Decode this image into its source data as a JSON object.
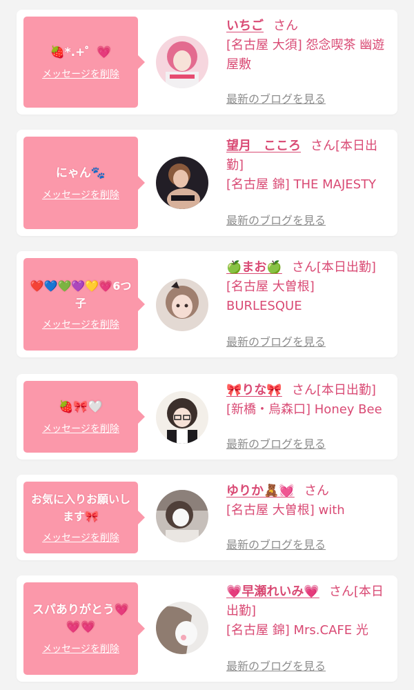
{
  "entries": [
    {
      "message": "🍓*.+゜💗",
      "delete_label": "メッセージを削除",
      "name": "いちご",
      "suffix": "さん",
      "shop": "[名古屋 大須] 怨念喫茶 幽遊屋敷",
      "blog_label": "最新のブログを見る",
      "avatar_colors": [
        "#f2b6c4",
        "#d94a74"
      ]
    },
    {
      "message": "にゃん🐾",
      "delete_label": "メッセージを削除",
      "name": "望月　こころ",
      "suffix": "さん[本日出勤]",
      "shop": "[名古屋 錦] THE MAJESTY",
      "blog_label": "最新のブログを見る",
      "avatar_colors": [
        "#2a2630",
        "#c9a48a"
      ]
    },
    {
      "message": "❤️💙💚💜💛💗6つ子",
      "delete_label": "メッセージを削除",
      "name": "🍏まお🍏",
      "suffix": "さん[本日出勤]",
      "shop": "[名古屋 大曽根] BURLESQUE",
      "blog_label": "最新のブログを見る",
      "avatar_colors": [
        "#e6dcd6",
        "#b29a8f"
      ]
    },
    {
      "message": "🍓🎀🤍",
      "delete_label": "メッセージを削除",
      "name": "🎀りな🎀",
      "suffix": "さん[本日出勤]",
      "shop": "[新橋・烏森口] Honey Bee",
      "blog_label": "最新のブログを見る",
      "avatar_colors": [
        "#f4eee8",
        "#3b2f2b"
      ]
    },
    {
      "message": "お気に入りお願いします🎀",
      "delete_label": "メッセージを削除",
      "name": "ゆりか🧸💓",
      "suffix": "さん",
      "shop": "[名古屋 大曽根] with",
      "blog_label": "最新のブログを見る",
      "avatar_colors": [
        "#b9b2ad",
        "#5a4a44"
      ]
    },
    {
      "message": "スパありがとう💗💗💗",
      "delete_label": "メッセージを削除",
      "name": "💗早瀬れいみ💗",
      "suffix": "さん[本日出勤]",
      "shop": "[名古屋 錦] Mrs.CAFE 光",
      "blog_label": "最新のブログを見る",
      "avatar_colors": [
        "#e9e6e4",
        "#9b8a80"
      ]
    }
  ]
}
